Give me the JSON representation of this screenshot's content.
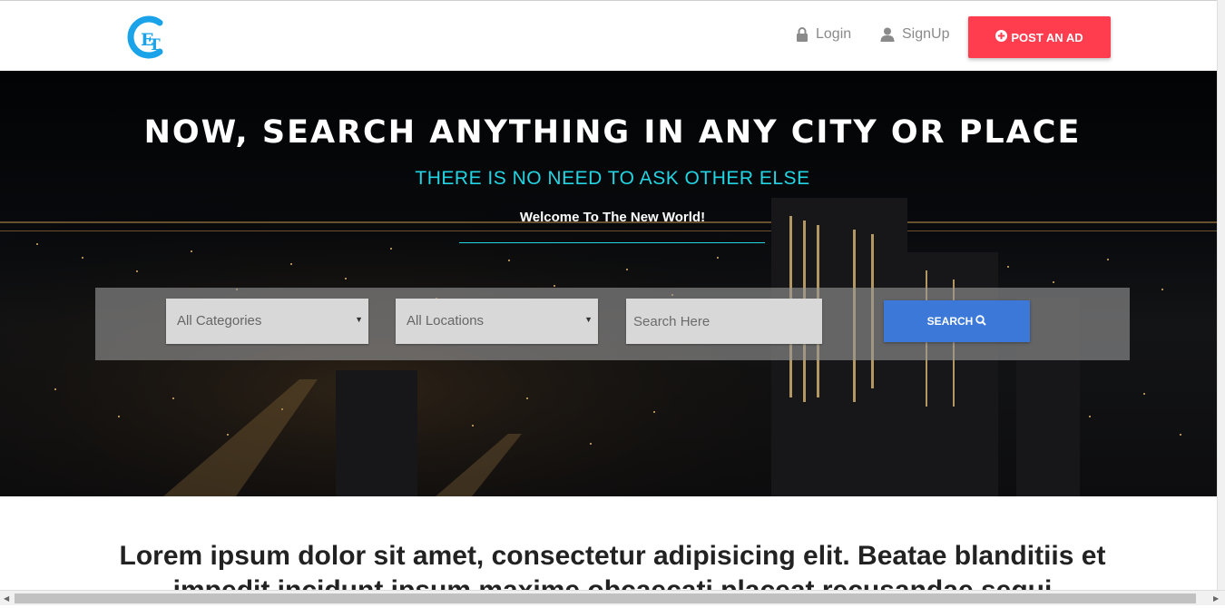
{
  "navbar": {
    "logo_text": "CET",
    "login_label": "Login",
    "signup_label": "SignUp",
    "post_ad_label": "POST AN AD"
  },
  "hero": {
    "title": "Now, search anything in any city or place",
    "subtitle": "THERE IS NO NEED TO ASK OTHER ELSE",
    "welcome": "Welcome To The New World!"
  },
  "search": {
    "category_selected": "All Categories",
    "location_selected": "All Locations",
    "placeholder": "Search Here",
    "button_label": "SEARCH"
  },
  "content": {
    "heading": "Lorem ipsum dolor sit amet, consectetur adipisicing elit. Beatae blanditiis et impedit incidunt ipsum maxime obcaecati placeat recusandae sequi"
  },
  "colors": {
    "brand": "#1aa3e8",
    "accent_red": "#ff3d4f",
    "button_blue": "#3c78d8",
    "cyan": "#23d5e2"
  },
  "icons": {
    "login": "lock-icon",
    "signup": "user-icon",
    "post_ad": "plus-circle-icon",
    "search": "search-icon"
  }
}
